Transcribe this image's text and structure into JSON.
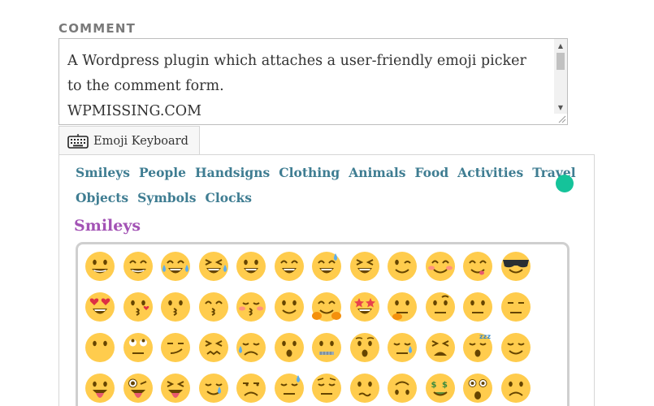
{
  "comment": {
    "label": "COMMENT",
    "lines": [
      "A Wordpress plugin which attaches a user-friendly emoji picker",
      "to the comment form.",
      "WPMISSING.COM"
    ]
  },
  "keyboard_tab": {
    "label": "Emoji Keyboard",
    "icon": "keyboard-icon"
  },
  "categories_row1": [
    "Smileys",
    "People",
    "Handsigns",
    "Clothing",
    "Animals",
    "Food",
    "Activities",
    "Travel"
  ],
  "categories_row2": [
    "Objects",
    "Symbols",
    "Clocks"
  ],
  "section_title": "Smileys",
  "colors": {
    "category_link": "#3f7d92",
    "section_title": "#a353b5",
    "emoji_face": "#ffcc4d",
    "badge": "#15c39a"
  },
  "emoji_rows": [
    [
      "grinning-face",
      "grinning-face-with-smiling-eyes",
      "face-with-tears-of-joy",
      "rolling-on-the-floor-laughing",
      "smiling-face-with-open-mouth",
      "smiling-face-with-open-mouth-and-smiling-eyes",
      "smiling-face-with-open-mouth-and-cold-sweat",
      "squinting-face",
      "winking-face",
      "smiling-face-with-smiling-eyes",
      "face-savouring-food",
      "smiling-face-with-sunglasses"
    ],
    [
      "smiling-face-with-heart-eyes",
      "face-blowing-a-kiss",
      "kissing-face",
      "kissing-face-with-smiling-eyes",
      "kissing-face-with-closed-eyes",
      "slightly-smiling-face",
      "hugging-face",
      "star-struck",
      "thinking-face",
      "face-with-raised-eyebrow",
      "neutral-face",
      "expressionless-face"
    ],
    [
      "face-without-mouth",
      "face-with-rolling-eyes",
      "smirking-face",
      "persevering-face",
      "sad-but-relieved-face",
      "face-with-open-mouth",
      "zipper-mouth-face",
      "hushed-face",
      "sleepy-face",
      "tired-face",
      "sleeping-face",
      "relieved-face"
    ],
    [
      "face-with-tongue",
      "winking-face-with-tongue",
      "squinting-face-with-tongue",
      "drooling-face",
      "unamused-face",
      "face-with-cold-sweat",
      "pensive-face",
      "confused-face",
      "upside-down-face",
      "money-mouth-face",
      "astonished-face",
      "frowning-face"
    ]
  ]
}
